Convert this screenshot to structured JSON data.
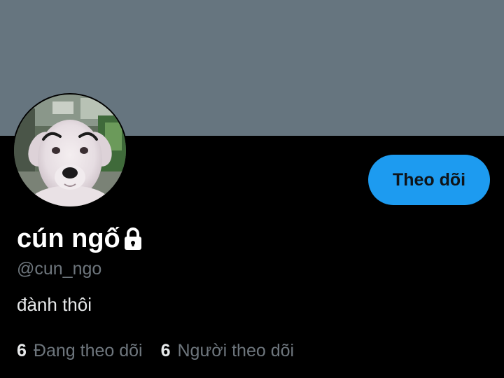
{
  "profile": {
    "display_name": "cún ngố",
    "handle": "@cun_ngo",
    "bio": "đành thôi",
    "avatar_icon": "puppy-avatar",
    "protected_icon": "lock-icon"
  },
  "actions": {
    "follow_label": "Theo dõi"
  },
  "stats": {
    "following_count": "6",
    "following_label": "Đang theo dõi",
    "followers_count": "6",
    "followers_label": "Người theo dõi"
  },
  "colors": {
    "banner": "#66757f",
    "background": "#000000",
    "accent": "#1d9bf0",
    "secondary_text": "#6e767d",
    "primary_text": "#e7e9ea"
  }
}
